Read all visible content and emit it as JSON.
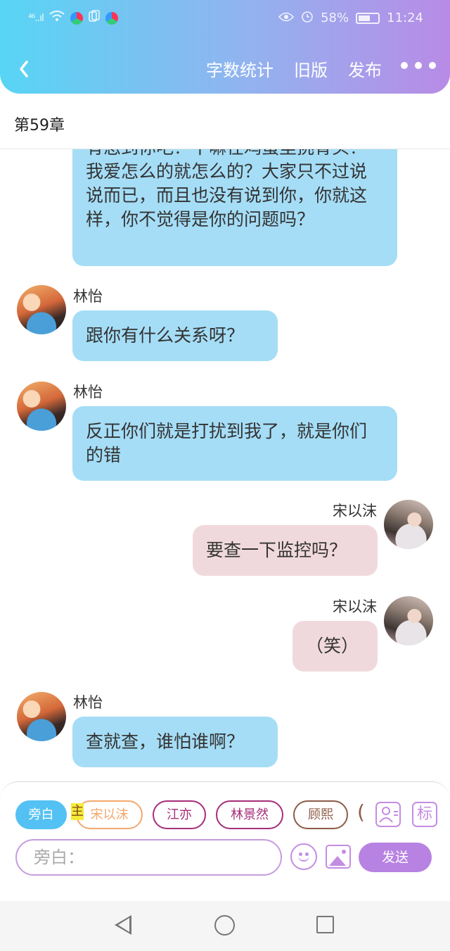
{
  "status_bar": {
    "signal": "⁴⁶..ıl",
    "battery_percent": "58%",
    "time": "11:24"
  },
  "header": {
    "back_icon": "chevron-left-icon",
    "word_count": "字数统计",
    "old_version": "旧版",
    "publish": "发布",
    "more_icon": "more-horizontal-icon"
  },
  "chapter_title": "第59章",
  "messages": [
    {
      "side": "left",
      "speaker": "",
      "text": "有怎到你吧？干嘛在鸡蛋里挑骨头？我爱怎么的就怎么的？大家只不过说说而已，而且也没有说到你，你就这样，你不觉得是你的问题吗？"
    },
    {
      "side": "left",
      "speaker": "林怡",
      "text": "跟你有什么关系呀？"
    },
    {
      "side": "left",
      "speaker": "林怡",
      "text": "反正你们就是打扰到我了，就是你们的错"
    },
    {
      "side": "right",
      "speaker": "宋以沫",
      "text": "要查一下监控吗？"
    },
    {
      "side": "right",
      "speaker": "宋以沫",
      "text": "（笑）"
    },
    {
      "side": "left",
      "speaker": "林怡",
      "text": "查就查，谁怕谁啊？"
    }
  ],
  "roles": {
    "narration": "旁白",
    "main_mark": "主",
    "song": "宋以沫",
    "jiang": "江亦",
    "lin": "林景然",
    "gu": "顾熙",
    "paren": "("
  },
  "toolbar": {
    "role_icon": "add-role-icon",
    "tag_label": "标",
    "input_placeholder": "旁白：",
    "send_label": "发送"
  },
  "colors": {
    "header_gradient": [
      "#57d5f4",
      "#b88be6"
    ],
    "left_bubble": "#a5ddf6",
    "right_bubble": "#f0d9dc",
    "accent": "#b782e2"
  }
}
